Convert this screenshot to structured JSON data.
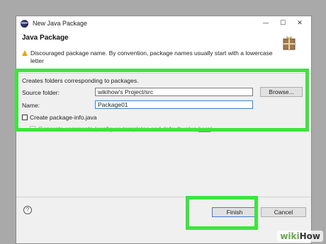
{
  "window": {
    "title": "New Java Package",
    "controls": {
      "minimize": "—",
      "maximize": "☐",
      "close": "✕"
    }
  },
  "header": {
    "title": "Java Package",
    "warning": "Discouraged package name. By convention, package names usually start with a lowercase letter"
  },
  "form": {
    "info": "Creates folders corresponding to packages.",
    "source_folder": {
      "label": "Source folder:",
      "value": "wikihow's Project/src",
      "browse_label": "Browse..."
    },
    "name": {
      "label": "Name:",
      "value": "Package01"
    },
    "create_package_info": {
      "label": "Create package-info.java",
      "checked": false
    },
    "generate_comments": {
      "label_prefix": "Generate comments (configure templates and default value ",
      "link_text": "here",
      "label_suffix": ")",
      "checked": false,
      "enabled": false
    }
  },
  "footer": {
    "help": "?",
    "finish_label": "Finish",
    "cancel_label": "Cancel"
  },
  "watermark": {
    "part1": "wiki",
    "part2": "How"
  },
  "colors": {
    "highlight": "#3fe33f",
    "accent": "#3c7fd6",
    "warning": "#e6a700"
  }
}
